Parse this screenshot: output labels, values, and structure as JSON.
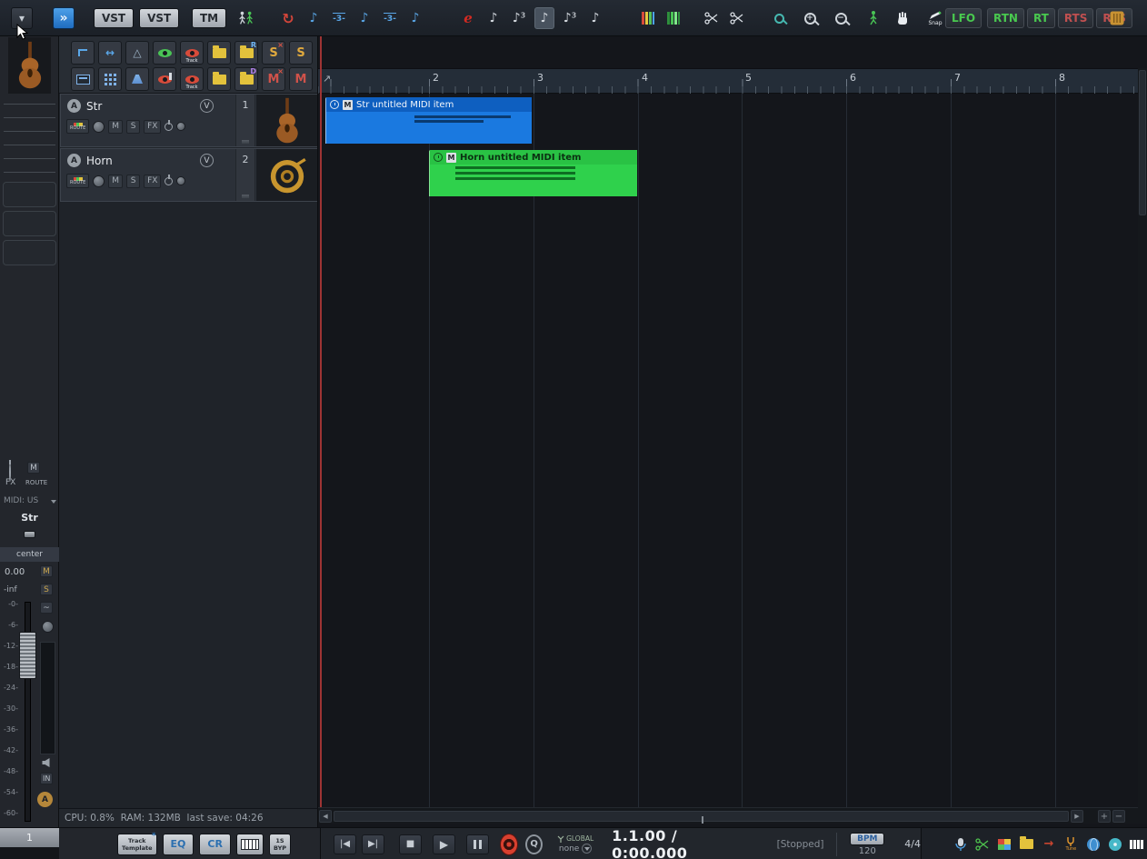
{
  "top_toolbar": {
    "dropdown_glyph": "▾",
    "render_glyph": "»",
    "vst1": "VST",
    "vst2": "VST",
    "tm": "TM",
    "loop_glyph": "↻",
    "grid_note_a": "♪",
    "grid_triplet_a": "-3-",
    "grid_note_b": "♪",
    "grid_triplet_b": "-3-",
    "grid_note_c": "♪",
    "env_glyph": "e",
    "len_note_a": "♪",
    "len_note_b": "♪³",
    "len_note_c": "♪",
    "len_note_d": "♪³",
    "len_note_e": "♪",
    "zoom_plus": "+",
    "zoom_minus": "−",
    "snap_label": "Snap",
    "lfo": "LFO",
    "rtn": "RTN",
    "rt": "RT",
    "rts1": "RTS",
    "rts2": "RTS"
  },
  "track_toolbar": {
    "track_label": "Track",
    "solo_letter": "S",
    "mute_letter": "M",
    "record_letter": "R",
    "device_letter": "D",
    "x_glyph": "×",
    "arrows_glyph": "↔",
    "triangle_glyph": "△"
  },
  "track_panel": {
    "tracks": [
      {
        "arm": "A",
        "name": "Str",
        "vca": "V",
        "route": "ROUTE",
        "mute": "M",
        "solo": "S",
        "fx": "FX",
        "number": "1"
      },
      {
        "arm": "A",
        "name": "Horn",
        "vca": "V",
        "route": "ROUTE",
        "mute": "M",
        "solo": "S",
        "fx": "FX",
        "number": "2"
      }
    ],
    "status": "CPU: 0.8%  RAM: 132MB  last save: 04:26"
  },
  "master_strip": {
    "mute_top": "M",
    "fx": "FX",
    "route": "ROUTE",
    "midi_device": "MIDI: US",
    "track_name": "Str",
    "pan_label": "center",
    "volume_readout": "0.00",
    "meter_readout": "-inf",
    "mute": "M",
    "solo": "S",
    "trim": "~",
    "scale": [
      "-0-",
      "-6-",
      "-12-",
      "-18-",
      "-24-",
      "-30-",
      "-36-",
      "-42-",
      "-48-",
      "-54-",
      "-60-"
    ],
    "input": "IN",
    "auto": "A"
  },
  "timeline": {
    "cursor_glyph": "↗",
    "ruler": [
      "2",
      "3",
      "4",
      "5",
      "6",
      "7",
      "8"
    ],
    "items": [
      {
        "icon": "M",
        "label": "Str untitled MIDI item"
      },
      {
        "icon": "M",
        "label": "Horn untitled MIDI item"
      }
    ],
    "hscroll": {
      "left": "◀",
      "right": "▶",
      "plus": "+",
      "minus": "−"
    }
  },
  "bottom_bar": {
    "pool_number": "1",
    "track_template_1": "Track",
    "track_template_2": "Template",
    "star": "*",
    "eq": "EQ",
    "cr": "CR",
    "bank_1": "1S",
    "bank_2": "BYP",
    "transport": {
      "prev": "|◀",
      "next": "▶|",
      "stop": "■",
      "play": "▶",
      "loop": "Q",
      "global_label": "GLOBAL",
      "global_value": "none",
      "time": "1.1.00 / 0:00.000",
      "state": "[Stopped]",
      "bpm_label": "BPM",
      "bpm_value": "120",
      "time_sig": "4/4"
    },
    "tune_label": "Tune",
    "arrow_glyph": "→"
  }
}
